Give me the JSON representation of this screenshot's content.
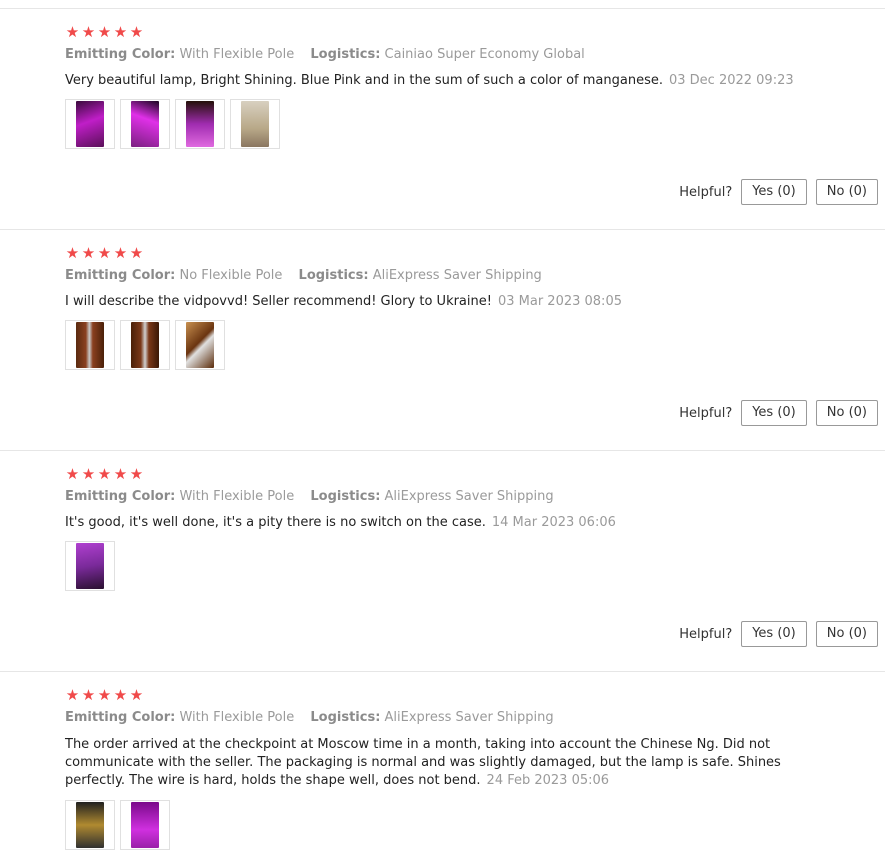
{
  "helpful_label": "Helpful?",
  "reviews": [
    {
      "stars": [
        "★",
        "★",
        "★",
        "★",
        "★"
      ],
      "color_label": "Emitting Color:",
      "color_value": "With Flexible Pole",
      "logistics_label": "Logistics:",
      "logistics_value": "Cainiao Super Economy Global",
      "text": "Very beautiful lamp, Bright Shining. Blue Pink and in the sum of such a color of manganese.",
      "date": "03 Dec 2022 09:23",
      "yes": "Yes (0)",
      "no": "No (0)"
    },
    {
      "stars": [
        "★",
        "★",
        "★",
        "★",
        "★"
      ],
      "color_label": "Emitting Color:",
      "color_value": "No Flexible Pole",
      "logistics_label": "Logistics:",
      "logistics_value": "AliExpress Saver Shipping",
      "text": "I will describe the vidpovvd! Seller recommend! Glory to Ukraine!",
      "date": "03 Mar 2023 08:05",
      "yes": "Yes (0)",
      "no": "No (0)"
    },
    {
      "stars": [
        "★",
        "★",
        "★",
        "★",
        "★"
      ],
      "color_label": "Emitting Color:",
      "color_value": "With Flexible Pole",
      "logistics_label": "Logistics:",
      "logistics_value": "AliExpress Saver Shipping",
      "text": "It's good, it's well done, it's a pity there is no switch on the case.",
      "date": "14 Mar 2023 06:06",
      "yes": "Yes (0)",
      "no": "No (0)"
    },
    {
      "stars": [
        "★",
        "★",
        "★",
        "★",
        "★"
      ],
      "color_label": "Emitting Color:",
      "color_value": "With Flexible Pole",
      "logistics_label": "Logistics:",
      "logistics_value": "AliExpress Saver Shipping",
      "text": "The order arrived at the checkpoint at Moscow time in a month, taking into account the Chinese Ng. Did not communicate with the seller. The packaging is normal and was slightly damaged, but the lamp is safe. Shines perfectly. The wire is hard, holds the shape well, does not bend.",
      "date": "24 Feb 2023 05:06"
    }
  ],
  "colors": {
    "star": "#f04a4a",
    "muted": "#9a9a9a",
    "divider": "#e6e6e6"
  }
}
